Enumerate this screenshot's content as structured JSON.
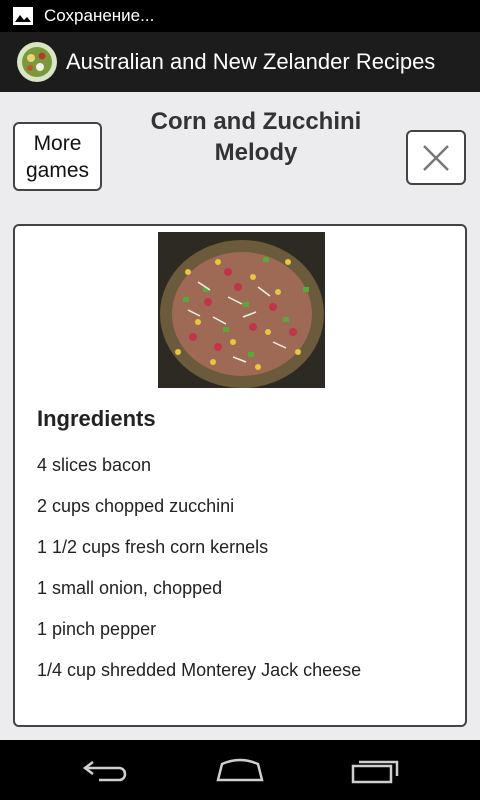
{
  "status_bar": {
    "notification_icon": "image-icon",
    "text": "Сохранение..."
  },
  "action_bar": {
    "logo_icon": "salad-dish-icon",
    "title": "Australian and New Zelander Recipes"
  },
  "header": {
    "more_games_label": "More\ngames",
    "recipe_title": "Corn and Zucchini Melody",
    "close_icon": "close-x-icon"
  },
  "card": {
    "photo_icon": "recipe-dish-photo",
    "ingredients_heading": "Ingredients",
    "ingredients": [
      "4 slices bacon",
      "2 cups chopped zucchini",
      "1 1/2 cups fresh corn kernels",
      "1 small onion, chopped",
      "1 pinch pepper",
      "1/4 cup shredded Monterey Jack cheese"
    ]
  },
  "nav_bar": {
    "back_icon": "back-icon",
    "home_icon": "home-icon",
    "recents_icon": "recent-apps-icon"
  },
  "colors": {
    "status_bar": "#000000",
    "action_bar": "#1c1c1c",
    "background": "#ececef",
    "border": "#444444"
  }
}
